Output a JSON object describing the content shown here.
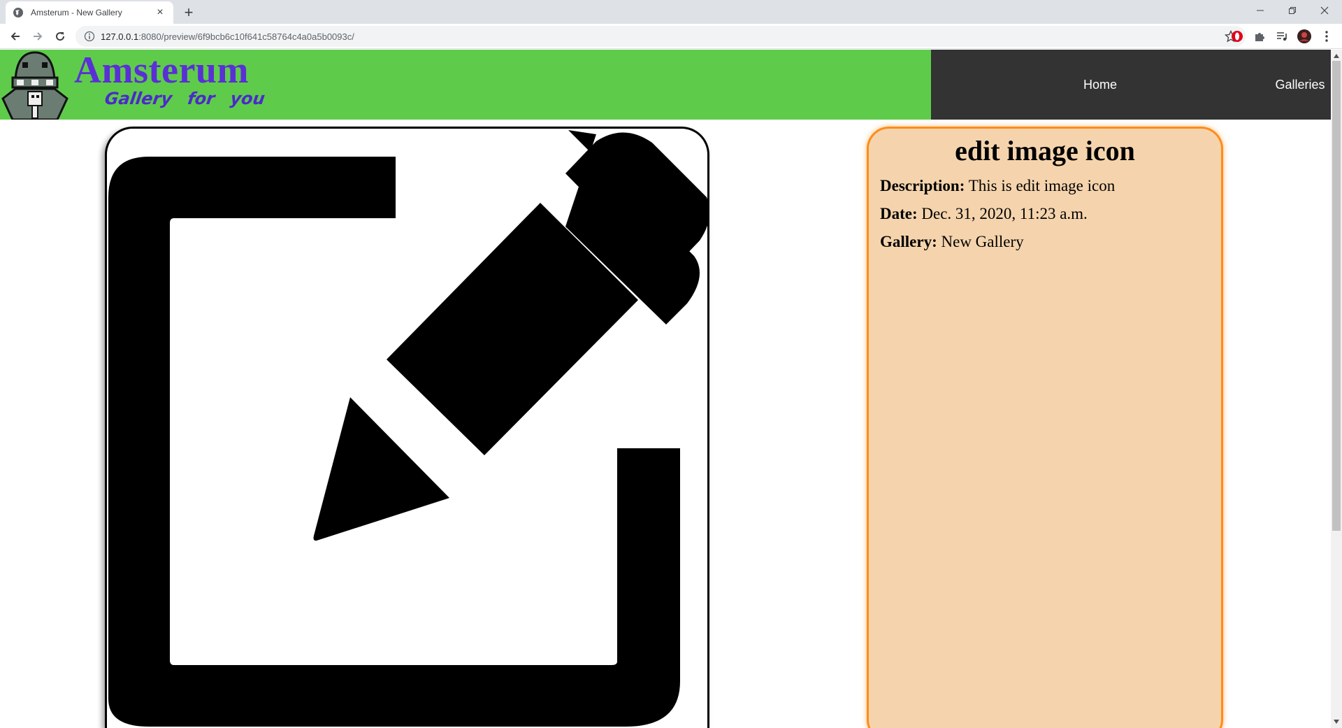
{
  "browser": {
    "tab_title": "Amsterum - New Gallery",
    "new_tab_symbol": "+",
    "close_symbol": "×",
    "url_host": "127.0.0.1",
    "url_rest": ":8080/preview/6f9bcb6c10f641c58764c4a0a5b0093c/"
  },
  "header": {
    "logo_title": "Amsterum",
    "logo_subtitle": "Gallery for you",
    "colors": {
      "green": "#5ecc4a",
      "nav_bg": "#333333",
      "logo": "#5a2fd6"
    }
  },
  "nav": {
    "items": [
      {
        "label": "Home"
      },
      {
        "label": "Galleries"
      }
    ]
  },
  "image": {
    "icon": "edit-image-icon"
  },
  "info": {
    "title": "edit image icon",
    "description_label": "Description:",
    "description": "This is edit image icon",
    "date_label": "Date:",
    "date": "Dec. 31, 2020, 11:23 a.m.",
    "gallery_label": "Gallery:",
    "gallery": "New Gallery"
  }
}
